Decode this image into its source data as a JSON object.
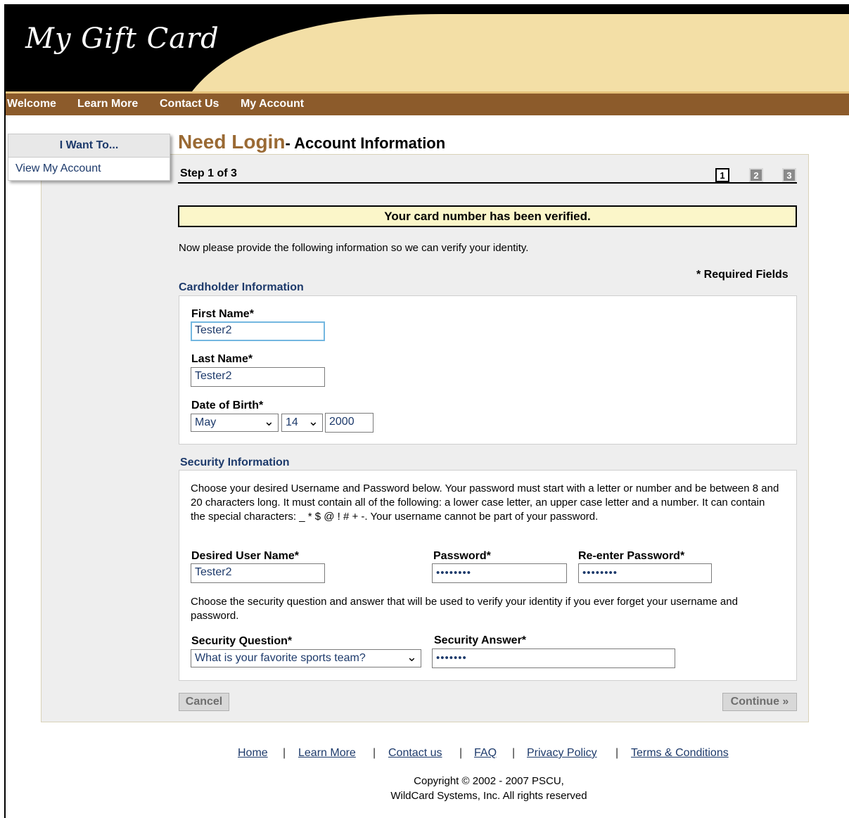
{
  "header": {
    "logo": "My Gift Card",
    "colors": {
      "header_bg": "#000000",
      "swoosh": "#f3dfa6",
      "nav_bg": "#8c5b2b",
      "title_accent": "#9a6a34",
      "link": "#1d3a6b"
    }
  },
  "nav": {
    "items": [
      {
        "label": "Welcome"
      },
      {
        "label": "Learn More"
      },
      {
        "label": "Contact Us"
      },
      {
        "label": "My Account"
      }
    ]
  },
  "sidebar": {
    "heading": "I Want To...",
    "link": "View My Account"
  },
  "page": {
    "title_main": "Need Login",
    "title_sub": "- Account Information",
    "step_label": "Step 1 of 3",
    "steps": [
      "1",
      "2",
      "3"
    ],
    "verified_message": "Your card number has been verified.",
    "intro": "Now please provide the following information so we can verify your identity.",
    "required_note": "* Required Fields"
  },
  "cardholder": {
    "section_title": "Cardholder Information",
    "first_name_label": "First Name*",
    "first_name_value": "Tester2",
    "last_name_label": "Last Name*",
    "last_name_value": "Tester2",
    "dob_label": "Date of Birth*",
    "dob_month": "May",
    "dob_day": "14",
    "dob_year": "2000"
  },
  "security": {
    "section_title": "Security Information",
    "instructions": "Choose your desired Username and Password below. Your password must start with a letter or number and be between 8 and 20 characters long. It must contain all of the following: a lower case letter, an upper case letter and a number. It can contain the special characters: _ * $ @ ! # + -. Your username cannot be part of your password.",
    "username_label": "Desired User Name*",
    "username_value": "Tester2",
    "password_label": "Password*",
    "password_value": "••••••••",
    "reenter_label": "Re-enter Password*",
    "reenter_value": "••••••••",
    "question_intro": "Choose the security question and answer that will be used to verify your identity if you ever forget your username and password.",
    "question_label": "Security Question*",
    "question_value": "What is your favorite sports team?",
    "answer_label": "Security Answer*",
    "answer_value": "•••••••"
  },
  "buttons": {
    "cancel": "Cancel",
    "continue": "Continue »"
  },
  "footer": {
    "links": [
      "Home",
      "Learn More",
      "Contact us",
      "FAQ",
      "Privacy Policy",
      "Terms & Conditions"
    ],
    "separator": "|",
    "copyright_line1": "Copyright © 2002 - 2007 PSCU,",
    "copyright_line2": "WildCard Systems, Inc. All rights reserved"
  }
}
